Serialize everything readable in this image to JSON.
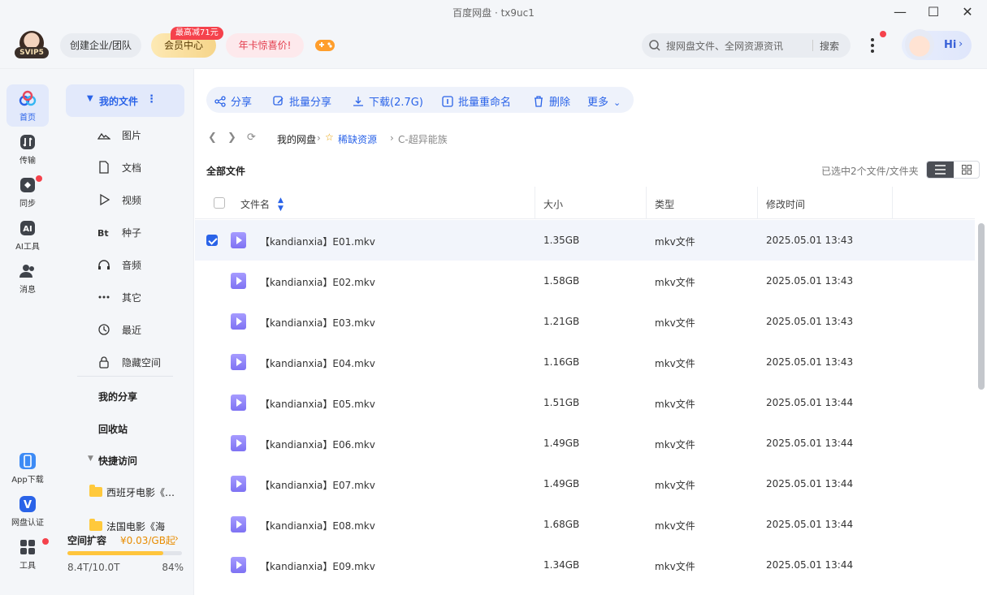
{
  "window": {
    "title": "百度网盘 · tx9uc1"
  },
  "topbar": {
    "vip_level": "SVIP5",
    "enterprise": "创建企业/团队",
    "member_center": "会员中心",
    "member_badge": "最高减71元",
    "year_card": "年卡惊喜价!",
    "search_placeholder": "搜网盘文件、全网资源资讯",
    "search_button": "搜索",
    "hi": "Hi"
  },
  "leftnav": {
    "items": [
      {
        "label": "首页",
        "icon": "cloud-icon"
      },
      {
        "label": "传输",
        "icon": "transfer-icon"
      },
      {
        "label": "同步",
        "icon": "sync-icon"
      },
      {
        "label": "AI工具",
        "icon": "ai-icon"
      },
      {
        "label": "消息",
        "icon": "message-icon"
      }
    ],
    "bottom": [
      {
        "label": "App下载",
        "icon": "phone-icon"
      },
      {
        "label": "网盘认证",
        "icon": "verify-icon"
      },
      {
        "label": "工具",
        "icon": "tools-icon"
      }
    ]
  },
  "sidebar": {
    "my_files": "我的文件",
    "categories": [
      {
        "label": "图片",
        "icon": "image-icon"
      },
      {
        "label": "文档",
        "icon": "document-icon"
      },
      {
        "label": "视频",
        "icon": "video-icon"
      },
      {
        "label": "种子",
        "icon": "torrent-icon"
      },
      {
        "label": "音频",
        "icon": "audio-icon"
      },
      {
        "label": "其它",
        "icon": "more-icon"
      },
      {
        "label": "最近",
        "icon": "clock-icon"
      },
      {
        "label": "隐藏空间",
        "icon": "lock-icon"
      }
    ],
    "my_share": "我的分享",
    "recycle": "回收站",
    "quick_access": "快捷访问",
    "quick_folders": [
      "西班牙电影《…",
      "法国电影《海"
    ],
    "quota": {
      "title": "空间扩容",
      "price": "¥0.03/GB起",
      "used": "8.4T/10.0T",
      "percent_text": "84%",
      "percent": 84
    }
  },
  "toolbar": {
    "share": "分享",
    "batch_share": "批量分享",
    "download": "下载(2.7G)",
    "batch_rename": "批量重命名",
    "delete": "删除",
    "more": "更多"
  },
  "breadcrumb": {
    "root": "我的网盘",
    "level1": "稀缺资源",
    "level2": "C-超异能族"
  },
  "listing": {
    "title": "全部文件",
    "selection": "已选中2个文件/文件夹",
    "columns": {
      "name": "文件名",
      "size": "大小",
      "type": "类型",
      "modified": "修改时间"
    },
    "rows": [
      {
        "name": "【kandianxia】E01.mkv",
        "size": "1.35GB",
        "type": "mkv文件",
        "modified": "2025.05.01 13:43",
        "checked": true
      },
      {
        "name": "【kandianxia】E02.mkv",
        "size": "1.58GB",
        "type": "mkv文件",
        "modified": "2025.05.01 13:43",
        "checked": false
      },
      {
        "name": "【kandianxia】E03.mkv",
        "size": "1.21GB",
        "type": "mkv文件",
        "modified": "2025.05.01 13:43",
        "checked": false
      },
      {
        "name": "【kandianxia】E04.mkv",
        "size": "1.16GB",
        "type": "mkv文件",
        "modified": "2025.05.01 13:43",
        "checked": false
      },
      {
        "name": "【kandianxia】E05.mkv",
        "size": "1.51GB",
        "type": "mkv文件",
        "modified": "2025.05.01 13:44",
        "checked": false
      },
      {
        "name": "【kandianxia】E06.mkv",
        "size": "1.49GB",
        "type": "mkv文件",
        "modified": "2025.05.01 13:44",
        "checked": false
      },
      {
        "name": "【kandianxia】E07.mkv",
        "size": "1.49GB",
        "type": "mkv文件",
        "modified": "2025.05.01 13:44",
        "checked": false
      },
      {
        "name": "【kandianxia】E08.mkv",
        "size": "1.68GB",
        "type": "mkv文件",
        "modified": "2025.05.01 13:44",
        "checked": false
      },
      {
        "name": "【kandianxia】E09.mkv",
        "size": "1.34GB",
        "type": "mkv文件",
        "modified": "2025.05.01 13:44",
        "checked": false
      }
    ]
  },
  "colors": {
    "accent": "#2a63e8",
    "badge": "#f5424c",
    "quota": "#ffc53d"
  }
}
